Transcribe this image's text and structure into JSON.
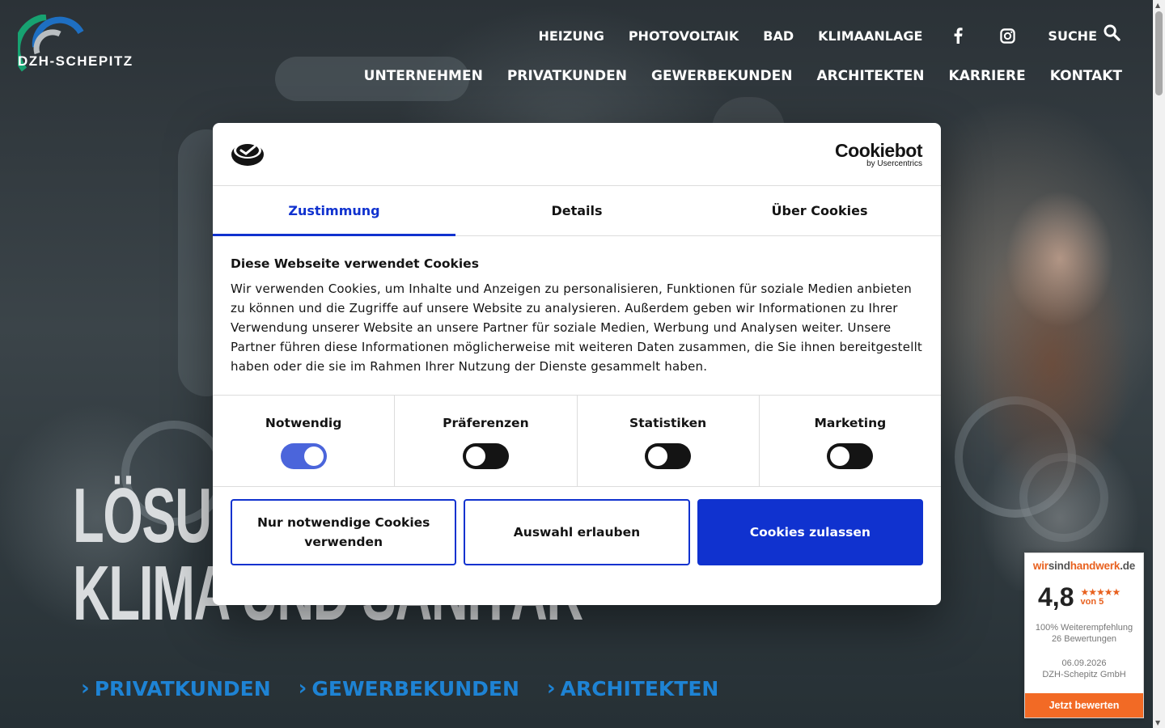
{
  "brand": {
    "name": "DZH-SCHEPITZ"
  },
  "nav_top": {
    "items": [
      "HEIZUNG",
      "PHOTOVOLTAIK",
      "BAD",
      "KLIMAANLAGE"
    ],
    "search_label": "SUCHE"
  },
  "nav_main": {
    "items": [
      "UNTERNEHMEN",
      "PRIVATKUNDEN",
      "GEWERBEKUNDEN",
      "ARCHITEKTEN",
      "KARRIERE",
      "KONTAKT"
    ]
  },
  "hero": {
    "title_line1": "LÖSUNGEN FÜR HEIZUNG,",
    "title_line2": "KLIMA UND SANITÄR",
    "links": [
      "PRIVATKUNDEN",
      "GEWERBEKUNDEN",
      "ARCHITEKTEN"
    ]
  },
  "cookie": {
    "brand_main": "Cookiebot",
    "brand_sub": "by Usercentrics",
    "tabs": [
      "Zustimmung",
      "Details",
      "Über Cookies"
    ],
    "heading": "Diese Webseite verwendet Cookies",
    "text": "Wir verwenden Cookies, um Inhalte und Anzeigen zu personalisieren, Funktionen für soziale Medien anbieten zu können und die Zugriffe auf unsere Website zu analysieren. Außerdem geben wir Informationen zu Ihrer Verwendung unserer Website an unsere Partner für soziale Medien, Werbung und Analysen weiter. Unsere Partner führen diese Informationen möglicherweise mit weiteren Daten zusammen, die Sie ihnen bereitgestellt haben oder die sie im Rahmen Ihrer Nutzung der Dienste gesammelt haben.",
    "toggles": [
      {
        "label": "Notwendig",
        "on": true
      },
      {
        "label": "Präferenzen",
        "on": false
      },
      {
        "label": "Statistiken",
        "on": false
      },
      {
        "label": "Marketing",
        "on": false
      }
    ],
    "buttons": {
      "necessary": "Nur notwendige Cookies verwenden",
      "selection": "Auswahl erlauben",
      "allow_all": "Cookies zulassen"
    }
  },
  "review": {
    "brand_parts": [
      "wir",
      "sind",
      "handwerk",
      ".de"
    ],
    "score": "4,8",
    "stars": "★★★★★",
    "out_of": "von 5",
    "recommendation": "100% Weiterempfehlung",
    "count": "26 Bewertungen",
    "date": "06.09.2026",
    "company": "DZH-Schepitz GmbH",
    "cta": "Jetzt bewerten"
  },
  "colors": {
    "accent": "#1032cf",
    "hero_link": "#1e83d4",
    "review_orange": "#f26a25"
  }
}
